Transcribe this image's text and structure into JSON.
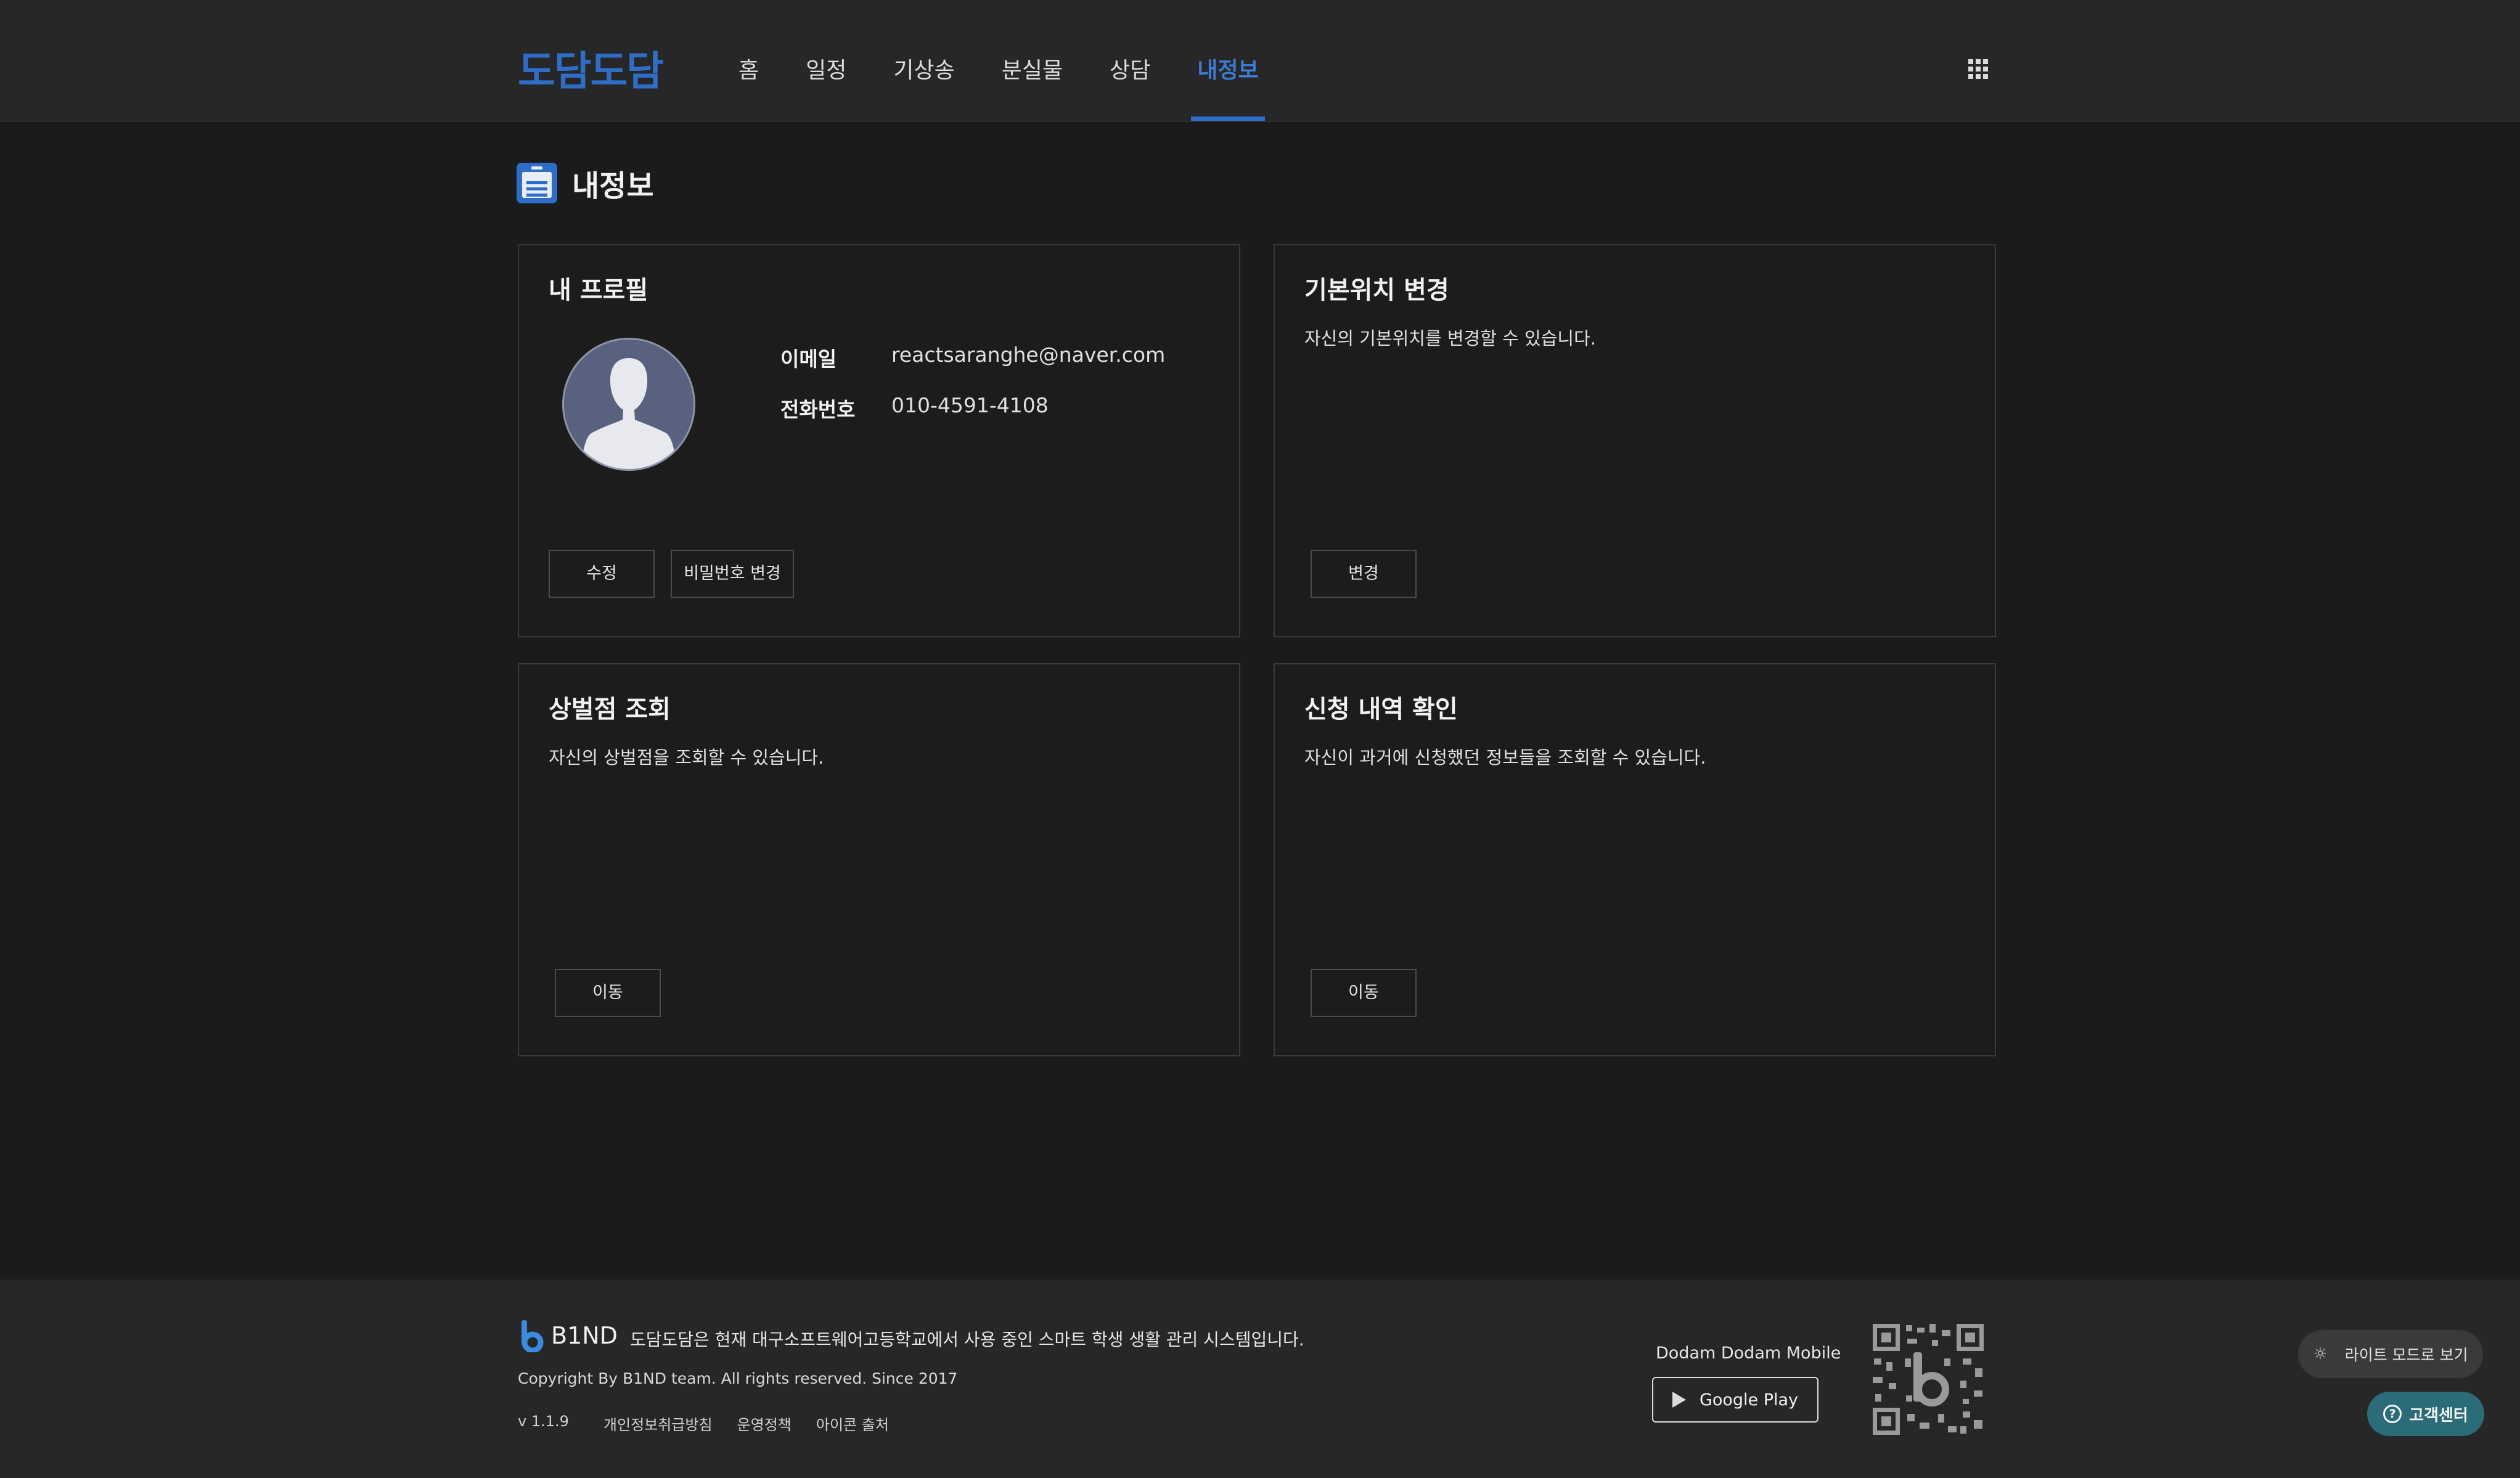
{
  "header": {
    "logo": "도담도담",
    "nav": [
      "홈",
      "일정",
      "기상송",
      "분실물",
      "상담",
      "내정보"
    ],
    "active_nav": "내정보",
    "apps_icon": "grid-icon"
  },
  "page": {
    "title": "내정보",
    "title_icon": "id-card-icon"
  },
  "profile_card": {
    "title": "내 프로필",
    "email_label": "이메일",
    "email_value": "reactsaranghe@naver.com",
    "phone_label": "전화번호",
    "phone_value": "010-4591-4108",
    "edit_button": "수정",
    "password_button": "비밀번호 변경",
    "avatar_icon": "user-avatar-icon"
  },
  "location_card": {
    "title": "기본위치 변경",
    "desc": "자신의 기본위치를 변경할 수 있습니다.",
    "button": "변경"
  },
  "points_card": {
    "title": "상벌점 조회",
    "desc": "자신의 상벌점을 조회할 수 있습니다.",
    "button": "이동"
  },
  "history_card": {
    "title": "신청 내역 확인",
    "desc": "자신이 과거에 신청했던 정보들을 조회할 수 있습니다.",
    "button": "이동"
  },
  "footer": {
    "brand": "B1ND",
    "description": "도담도담은 현재 대구소프트웨어고등학교에서 사용 중인 스마트 학생 생활 관리 시스템입니다.",
    "copyright": "Copyright By B1ND team. All rights reserved. Since 2017",
    "version": "v 1.1.9",
    "links": [
      "개인정보취급방침",
      "운영정책",
      "아이콘 출처"
    ],
    "mobile_label": "Dodam Dodam Mobile",
    "google_play": "Google Play"
  },
  "floating": {
    "light_mode": "라이트 모드로 보기",
    "help": "고객센터"
  },
  "colors": {
    "accent": "#2f6ec8",
    "background": "#1b1b1b",
    "header": "#272727",
    "help_button": "#2b6c79"
  }
}
